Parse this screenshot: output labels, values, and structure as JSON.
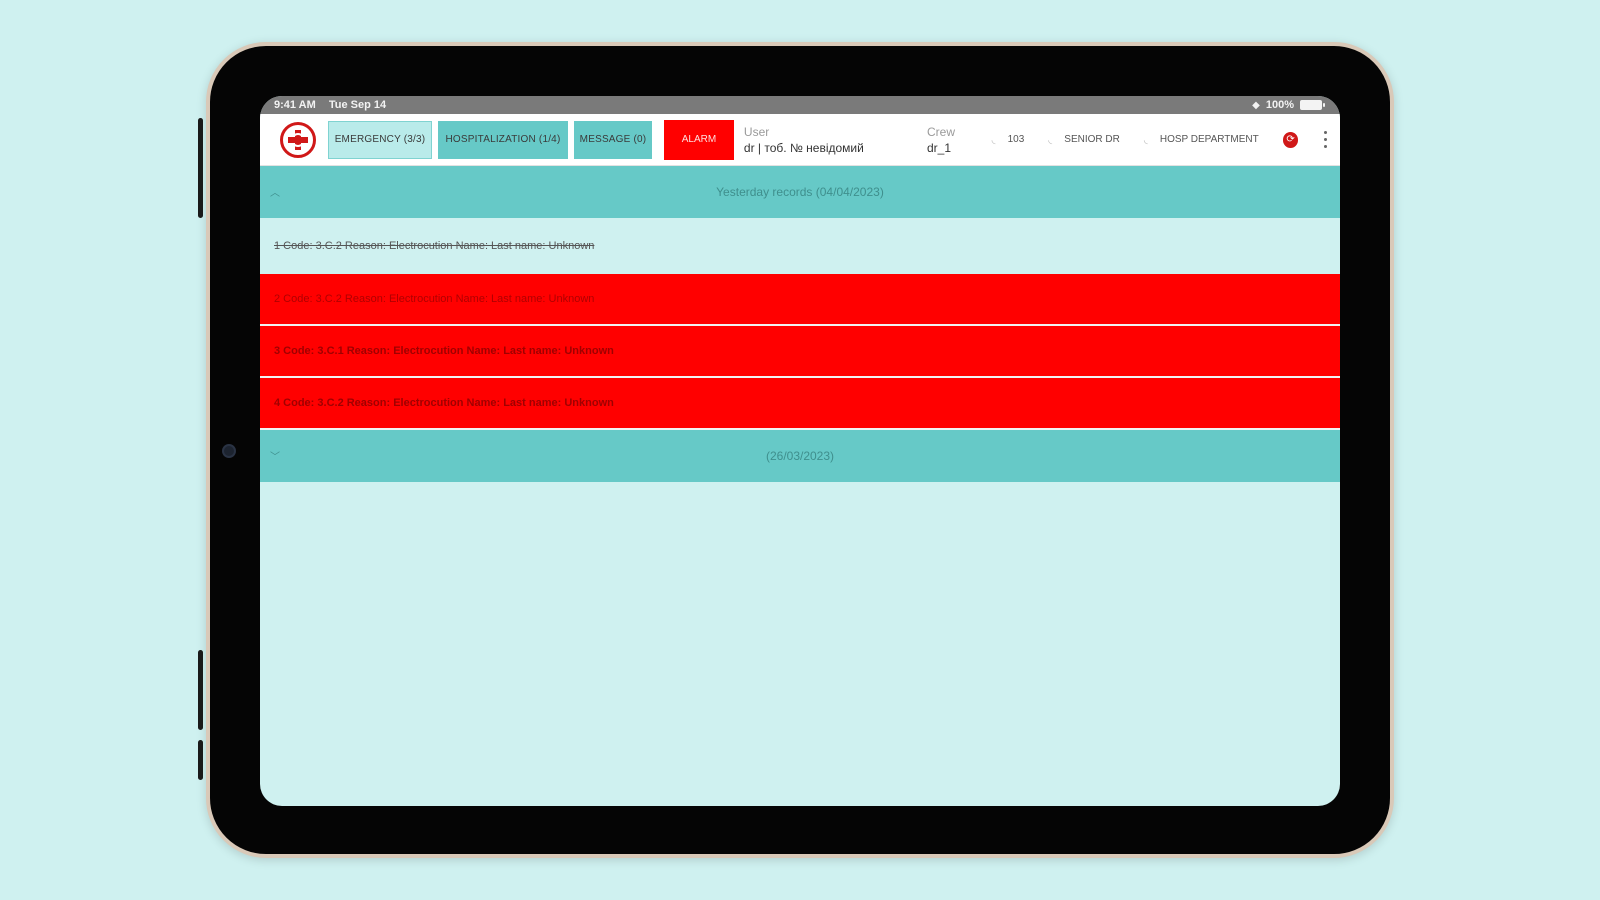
{
  "statusbar": {
    "time": "9:41 AM",
    "date": "Tue Sep 14",
    "battery": "100%"
  },
  "toolbar": {
    "tabs": [
      {
        "label": "EMERGENCY (3/3)"
      },
      {
        "label": "HOSPITALIZATION (1/4)"
      },
      {
        "label": "MESSAGE (0)"
      }
    ],
    "alarm_label": "ALARM",
    "user_label": "User",
    "user_value": "dr | тоб. № невідомий",
    "crew_label": "Crew",
    "crew_value": "dr_1",
    "chips": [
      {
        "label": "103"
      },
      {
        "label": "SENIOR DR"
      },
      {
        "label": "HOSP DEPARTMENT"
      }
    ]
  },
  "groups": [
    {
      "title": "Yesterday records (04/04/2023)",
      "records": [
        {
          "text": "1 Code: 3.C.2 Reason: Electrocution Name:  Last name: Unknown",
          "state": "done"
        },
        {
          "text": "2 Code: 3.C.2 Reason: Electrocution Name:  Last name: Unknown",
          "state": "alert"
        },
        {
          "text": "3 Code: 3.C.1 Reason: Electrocution Name:  Last name: Unknown",
          "state": "alert-bold"
        },
        {
          "text": "4 Code: 3.C.2 Reason: Electrocution Name:  Last name: Unknown",
          "state": "alert-bold"
        }
      ]
    },
    {
      "title": "(26/03/2023)",
      "records": []
    }
  ],
  "colors": {
    "background": "#cff1f0",
    "header": "#66c9c7",
    "alert": "#ff0000",
    "logo": "#d01818"
  }
}
